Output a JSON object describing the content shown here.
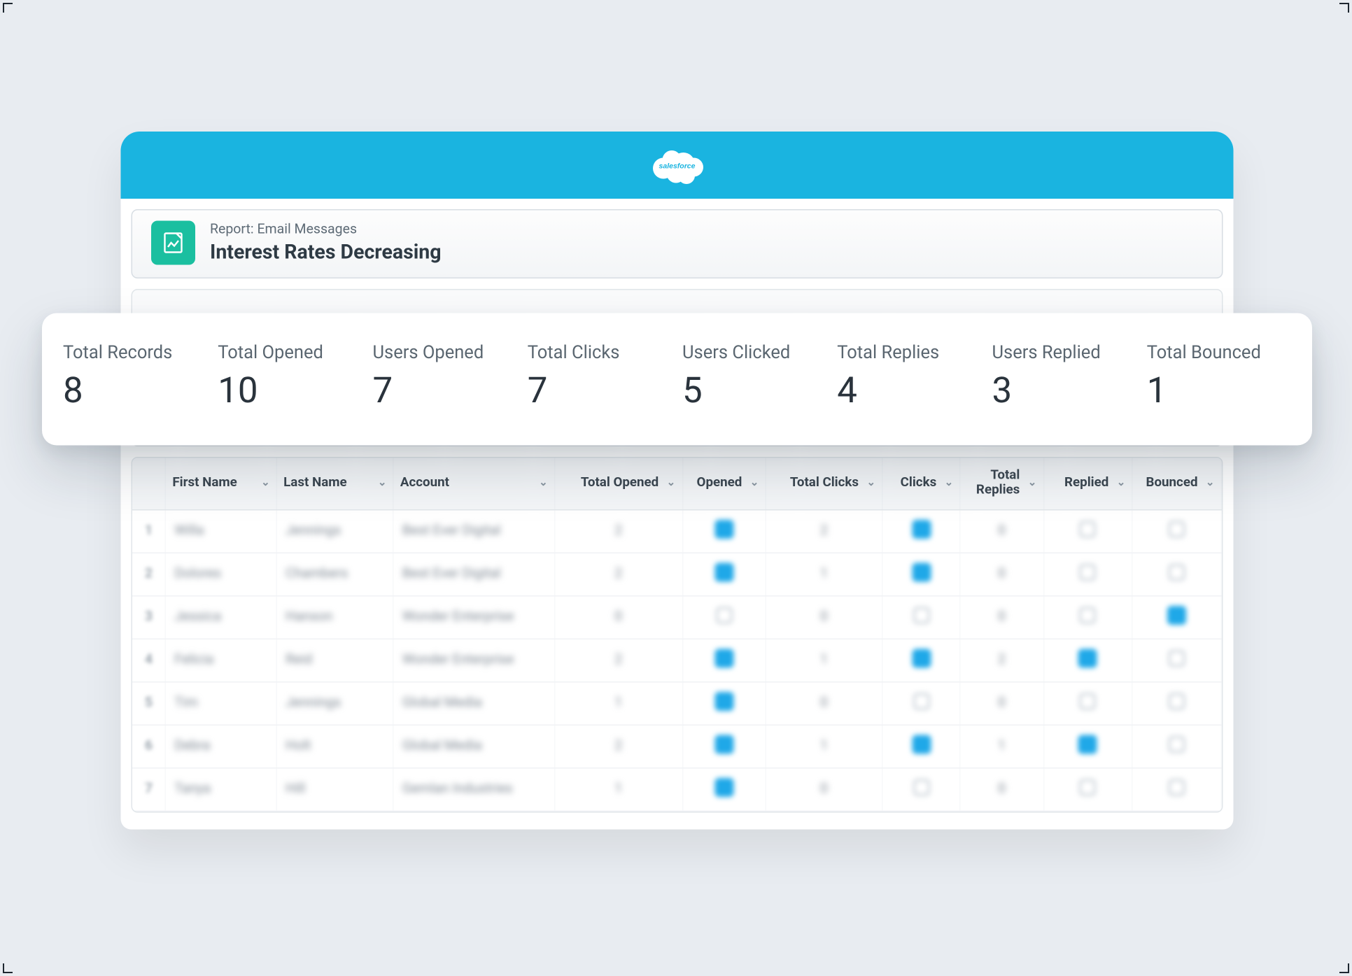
{
  "header": {
    "brand": "salesforce",
    "subtitle": "Report: Email Messages",
    "title": "Interest Rates Decreasing"
  },
  "summary": [
    {
      "label": "Total Records",
      "value": "8"
    },
    {
      "label": "Total Opened",
      "value": "10"
    },
    {
      "label": "Users  Opened",
      "value": "7"
    },
    {
      "label": "Total Clicks",
      "value": "7"
    },
    {
      "label": "Users Clicked",
      "value": "5"
    },
    {
      "label": "Total Replies",
      "value": "4"
    },
    {
      "label": "Users Replied",
      "value": "3"
    },
    {
      "label": "Total Bounced",
      "value": "1"
    }
  ],
  "table": {
    "columns": {
      "first_name": "First Name",
      "last_name": "Last Name",
      "account": "Account",
      "total_opened": "Total Opened",
      "opened": "Opened",
      "total_clicks": "Total Clicks",
      "clicks": "Clicks",
      "total_replies": "Total Replies",
      "replied": "Replied",
      "bounced": "Bounced"
    },
    "rows": [
      {
        "idx": "1",
        "first": "Willa",
        "last": "Jennings",
        "account": "Best Ever Digital",
        "total_opened": "2",
        "opened": true,
        "total_clicks": "2",
        "clicks": true,
        "total_replies": "0",
        "replied": false,
        "bounced": false
      },
      {
        "idx": "2",
        "first": "Dolores",
        "last": "Chambers",
        "account": "Best Ever Digital",
        "total_opened": "2",
        "opened": true,
        "total_clicks": "1",
        "clicks": true,
        "total_replies": "0",
        "replied": false,
        "bounced": false
      },
      {
        "idx": "3",
        "first": "Jessica",
        "last": "Hanson",
        "account": "Wonder Enterprise",
        "total_opened": "0",
        "opened": false,
        "total_clicks": "0",
        "clicks": false,
        "total_replies": "0",
        "replied": false,
        "bounced": true
      },
      {
        "idx": "4",
        "first": "Felicia",
        "last": "Reid",
        "account": "Wonder Enterprise",
        "total_opened": "2",
        "opened": true,
        "total_clicks": "1",
        "clicks": true,
        "total_replies": "2",
        "replied": true,
        "bounced": false
      },
      {
        "idx": "5",
        "first": "Tim",
        "last": "Jennings",
        "account": "Global Media",
        "total_opened": "1",
        "opened": true,
        "total_clicks": "0",
        "clicks": false,
        "total_replies": "0",
        "replied": false,
        "bounced": false
      },
      {
        "idx": "6",
        "first": "Debra",
        "last": "Holt",
        "account": "Global Media",
        "total_opened": "2",
        "opened": true,
        "total_clicks": "1",
        "clicks": true,
        "total_replies": "1",
        "replied": true,
        "bounced": false
      },
      {
        "idx": "7",
        "first": "Tanya",
        "last": "Hill",
        "account": "Gemlan Industries",
        "total_opened": "1",
        "opened": true,
        "total_clicks": "0",
        "clicks": false,
        "total_replies": "0",
        "replied": false,
        "bounced": false
      }
    ]
  }
}
